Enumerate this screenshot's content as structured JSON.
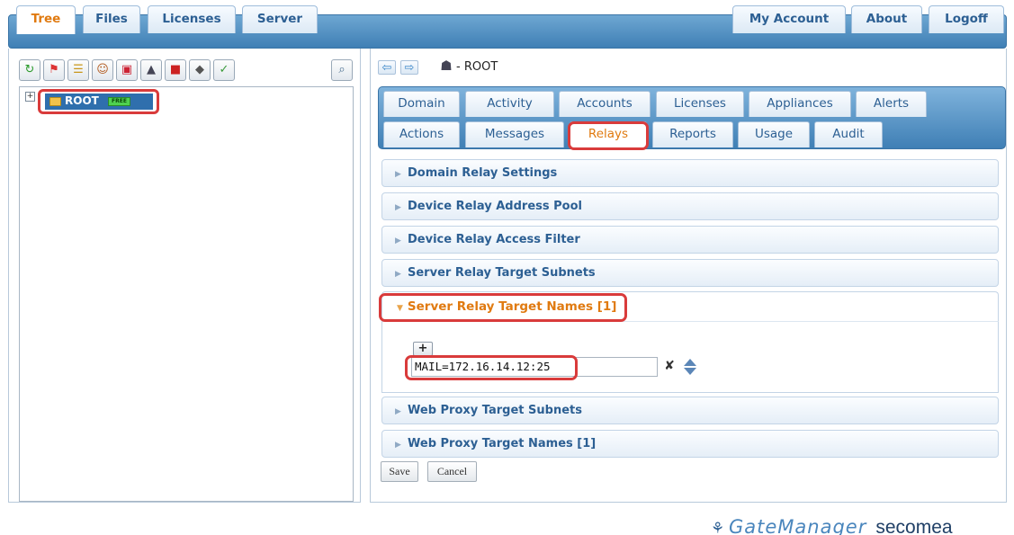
{
  "top_tabs": {
    "left": [
      "Tree",
      "Files",
      "Licenses",
      "Server"
    ],
    "right": [
      "My Account",
      "About",
      "Logoff"
    ],
    "active": "Tree"
  },
  "toolbar": {
    "icons": [
      "refresh-icon",
      "pin-icon",
      "tree-icon",
      "user-icon",
      "monitor-icon",
      "bell-icon",
      "toolbox-icon",
      "disk-icon",
      "check-icon"
    ],
    "search_icon": "magnifier-icon"
  },
  "tree": {
    "expander": "+",
    "root_label": "ROOT",
    "root_badge": "FREE"
  },
  "breadcrumb": {
    "icon": "domain-icon",
    "text": "- ROOT"
  },
  "domain_tabs": {
    "row1": [
      "Domain",
      "Activity",
      "Accounts",
      "Licenses",
      "Appliances",
      "Alerts"
    ],
    "row2": [
      "Actions",
      "Messages",
      "Relays",
      "Reports",
      "Usage",
      "Audit"
    ],
    "active": "Relays"
  },
  "sections": {
    "collapsed_before": [
      "Domain Relay Settings",
      "Device Relay Address Pool",
      "Device Relay Access Filter",
      "Server Relay Target Subnets"
    ],
    "open": {
      "title": "Server Relay Target Names [1]",
      "add_label": "+",
      "entry_value": "MAIL=172.16.14.12:25"
    },
    "collapsed_after": [
      "Web Proxy Target Subnets",
      "Web Proxy Target Names [1]"
    ]
  },
  "buttons": {
    "save": "Save",
    "cancel": "Cancel"
  },
  "footer": {
    "product": "GateManager",
    "company": "secomea"
  },
  "colors": {
    "header_blue": "#3f7fb5",
    "active_orange": "#e07a10",
    "highlight_red": "#d93b3b",
    "link_blue": "#2c5f93"
  }
}
